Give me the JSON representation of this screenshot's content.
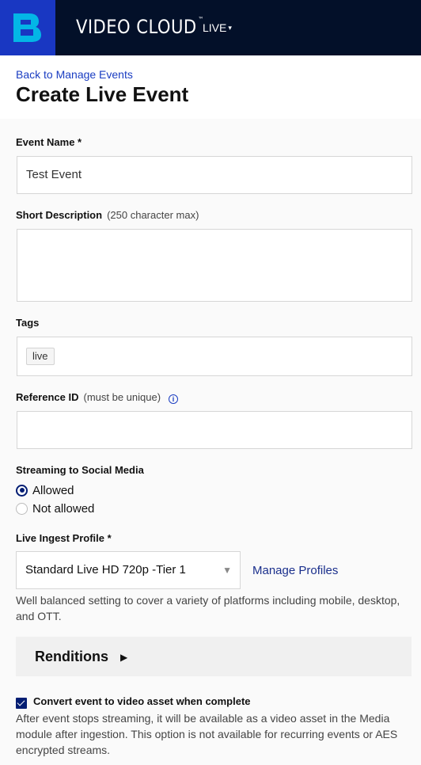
{
  "header": {
    "brand": "VIDEO CLOUD",
    "brand_tm": "™",
    "module": "LIVE",
    "module_caret": "▾",
    "logo_icon": "brightcove-b-logo"
  },
  "page": {
    "back_link": "Back to Manage Events",
    "title": "Create Live Event"
  },
  "form": {
    "event_name": {
      "label": "Event Name *",
      "value": "Test Event"
    },
    "short_description": {
      "label": "Short Description",
      "hint": "(250 character max)",
      "value": ""
    },
    "tags": {
      "label": "Tags",
      "items": [
        "live"
      ]
    },
    "reference_id": {
      "label": "Reference ID",
      "hint": "(must be unique)",
      "info_icon": "i",
      "value": ""
    },
    "social_media": {
      "label": "Streaming to Social Media",
      "options": [
        "Allowed",
        "Not allowed"
      ],
      "selected": "Allowed"
    },
    "ingest_profile": {
      "label": "Live Ingest Profile *",
      "selected": "Standard Live HD 720p -Tier 1",
      "arrow": "▼",
      "manage_link": "Manage Profiles",
      "help": "Well balanced setting to cover a variety of platforms including mobile, desktop, and OTT."
    },
    "renditions": {
      "label": "Renditions",
      "caret": "▶"
    },
    "convert_to_asset": {
      "checked": true,
      "label": "Convert event to video asset when complete",
      "help": "After event stops streaming, it will be available as a video asset in the Media module after ingestion. This option is not available for recurring events or AES encrypted streams."
    }
  },
  "colors": {
    "header_bg": "#031029",
    "logo_bg": "#1937c2",
    "link": "#1a3dc2",
    "control_accent": "#031d73"
  }
}
